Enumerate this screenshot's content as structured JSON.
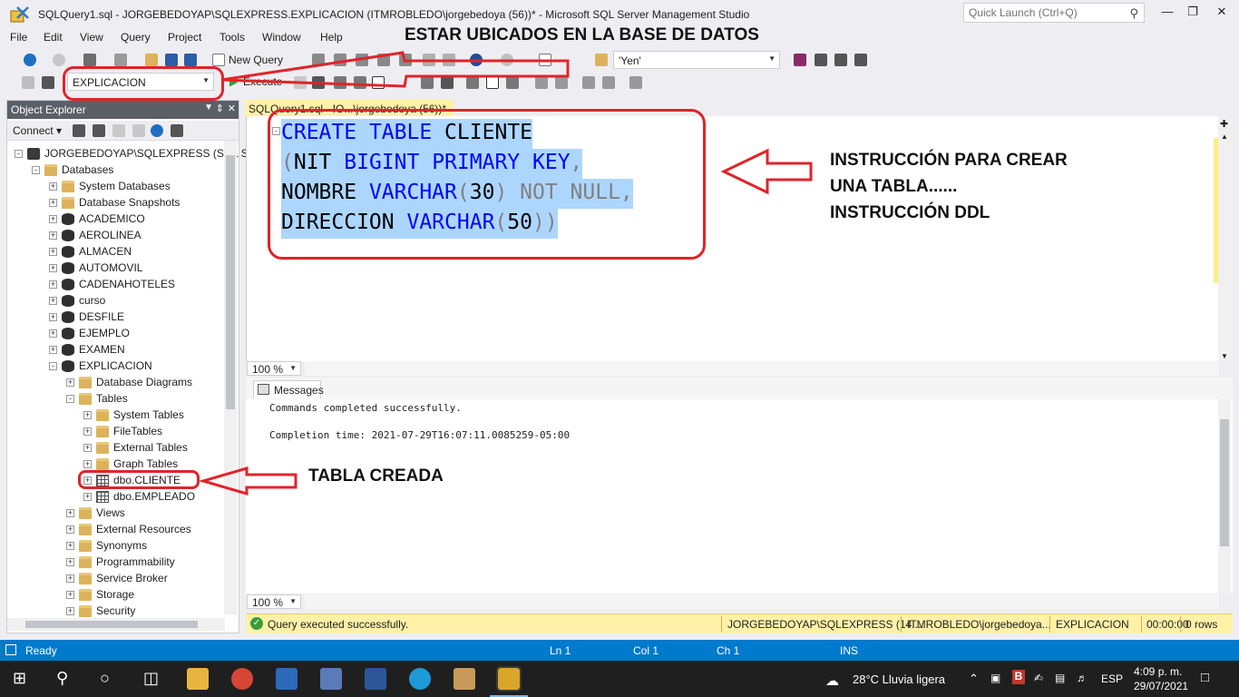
{
  "window": {
    "title": "SQLQuery1.sql - JORGEBEDOYAP\\SQLEXPRESS.EXPLICACION (ITMROBLEDO\\jorgebedoya (56))* - Microsoft SQL Server Management Studio",
    "quick_launch_placeholder": "Quick Launch (Ctrl+Q)"
  },
  "menu": [
    "File",
    "Edit",
    "View",
    "Query",
    "Project",
    "Tools",
    "Window",
    "Help"
  ],
  "toolbar": {
    "new_query": "New Query",
    "search_value": "'Yen'",
    "database": "EXPLICACION",
    "execute": "Execute"
  },
  "object_explorer": {
    "title": "Object Explorer",
    "connect": "Connect",
    "tree": [
      {
        "label": "JORGEBEDOYAP\\SQLEXPRESS (SQL S",
        "icon": "server",
        "level": 0,
        "exp": "-"
      },
      {
        "label": "Databases",
        "icon": "folder",
        "level": 1,
        "exp": "-"
      },
      {
        "label": "System Databases",
        "icon": "folder",
        "level": 2,
        "exp": "+"
      },
      {
        "label": "Database Snapshots",
        "icon": "folder",
        "level": 2,
        "exp": "+"
      },
      {
        "label": "ACADEMICO",
        "icon": "db",
        "level": 2,
        "exp": "+"
      },
      {
        "label": "AEROLINEA",
        "icon": "db",
        "level": 2,
        "exp": "+"
      },
      {
        "label": "ALMACEN",
        "icon": "db",
        "level": 2,
        "exp": "+"
      },
      {
        "label": "AUTOMOVIL",
        "icon": "db",
        "level": 2,
        "exp": "+"
      },
      {
        "label": "CADENAHOTELES",
        "icon": "db",
        "level": 2,
        "exp": "+"
      },
      {
        "label": "curso",
        "icon": "db",
        "level": 2,
        "exp": "+"
      },
      {
        "label": "DESFILE",
        "icon": "db",
        "level": 2,
        "exp": "+"
      },
      {
        "label": "EJEMPLO",
        "icon": "db",
        "level": 2,
        "exp": "+"
      },
      {
        "label": "EXAMEN",
        "icon": "db",
        "level": 2,
        "exp": "+"
      },
      {
        "label": "EXPLICACION",
        "icon": "db",
        "level": 2,
        "exp": "-"
      },
      {
        "label": "Database Diagrams",
        "icon": "folder",
        "level": 3,
        "exp": "+"
      },
      {
        "label": "Tables",
        "icon": "folder",
        "level": 3,
        "exp": "-"
      },
      {
        "label": "System Tables",
        "icon": "folder",
        "level": 4,
        "exp": "+"
      },
      {
        "label": "FileTables",
        "icon": "folder",
        "level": 4,
        "exp": "+"
      },
      {
        "label": "External Tables",
        "icon": "folder",
        "level": 4,
        "exp": "+"
      },
      {
        "label": "Graph Tables",
        "icon": "folder",
        "level": 4,
        "exp": "+"
      },
      {
        "label": "dbo.CLIENTE",
        "icon": "table",
        "level": 4,
        "exp": "+"
      },
      {
        "label": "dbo.EMPLEADO",
        "icon": "table",
        "level": 4,
        "exp": "+"
      },
      {
        "label": "Views",
        "icon": "folder",
        "level": 3,
        "exp": "+"
      },
      {
        "label": "External Resources",
        "icon": "folder",
        "level": 3,
        "exp": "+"
      },
      {
        "label": "Synonyms",
        "icon": "folder",
        "level": 3,
        "exp": "+"
      },
      {
        "label": "Programmability",
        "icon": "folder",
        "level": 3,
        "exp": "+"
      },
      {
        "label": "Service Broker",
        "icon": "folder",
        "level": 3,
        "exp": "+"
      },
      {
        "label": "Storage",
        "icon": "folder",
        "level": 3,
        "exp": "+"
      },
      {
        "label": "Security",
        "icon": "folder",
        "level": 3,
        "exp": "+"
      }
    ]
  },
  "editor": {
    "tab_label": "SQLQuery1.sql - IO...\\jorgebedoya (56))*",
    "zoom": "100 %",
    "lines": [
      [
        {
          "t": "CREATE",
          "c": "kw"
        },
        {
          "t": " ",
          "c": "bk"
        },
        {
          "t": "TABLE",
          "c": "kw"
        },
        {
          "t": " CLIENTE",
          "c": "bk"
        }
      ],
      [
        {
          "t": "(",
          "c": "gr"
        },
        {
          "t": "NIT ",
          "c": "bk"
        },
        {
          "t": "BIGINT",
          "c": "kw"
        },
        {
          "t": " ",
          "c": "bk"
        },
        {
          "t": "PRIMARY",
          "c": "kw"
        },
        {
          "t": " ",
          "c": "bk"
        },
        {
          "t": "KEY",
          "c": "kw"
        },
        {
          "t": ",",
          "c": "gr"
        }
      ],
      [
        {
          "t": "NOMBRE ",
          "c": "bk"
        },
        {
          "t": "VARCHAR",
          "c": "kw"
        },
        {
          "t": "(",
          "c": "gr"
        },
        {
          "t": "30",
          "c": "bk"
        },
        {
          "t": ") ",
          "c": "gr"
        },
        {
          "t": "NOT NULL",
          "c": "gr"
        },
        {
          "t": ",",
          "c": "gr"
        }
      ],
      [
        {
          "t": "DIRECCION ",
          "c": "bk"
        },
        {
          "t": "VARCHAR",
          "c": "kw"
        },
        {
          "t": "(",
          "c": "gr"
        },
        {
          "t": "50",
          "c": "bk"
        },
        {
          "t": "))",
          "c": "gr"
        }
      ]
    ]
  },
  "results": {
    "tab_label": "Messages",
    "zoom": "100 %",
    "messages": [
      "Commands completed successfully.",
      "Completion time: 2021-07-29T16:07:11.0085259-05:00"
    ]
  },
  "query_status": {
    "message": "Query executed successfully.",
    "server": "JORGEBEDOYAP\\SQLEXPRESS (14....",
    "user": "ITMROBLEDO\\jorgebedoya...",
    "database": "EXPLICACION",
    "time": "00:00:00",
    "rows": "0 rows"
  },
  "status_bar": {
    "ready": "Ready",
    "ln": "Ln 1",
    "col": "Col 1",
    "ch": "Ch 1",
    "ins": "INS"
  },
  "taskbar": {
    "weather": "28°C  Lluvia ligera",
    "lang": "ESP",
    "time": "4:09 p. m.",
    "date": "29/07/2021"
  },
  "annotations": {
    "db_note": "ESTAR UBICADOS EN LA BASE DE DATOS",
    "ddl_note_1": "INSTRUCCIÓN PARA CREAR",
    "ddl_note_2": "UNA TABLA......",
    "ddl_note_3": "INSTRUCCIÓN DDL",
    "table_note": "TABLA CREADA"
  },
  "colors": {
    "accent": "#007acc",
    "annotation_red": "#e0242a",
    "selection": "#add6ff",
    "keyword": "#0000ff"
  }
}
